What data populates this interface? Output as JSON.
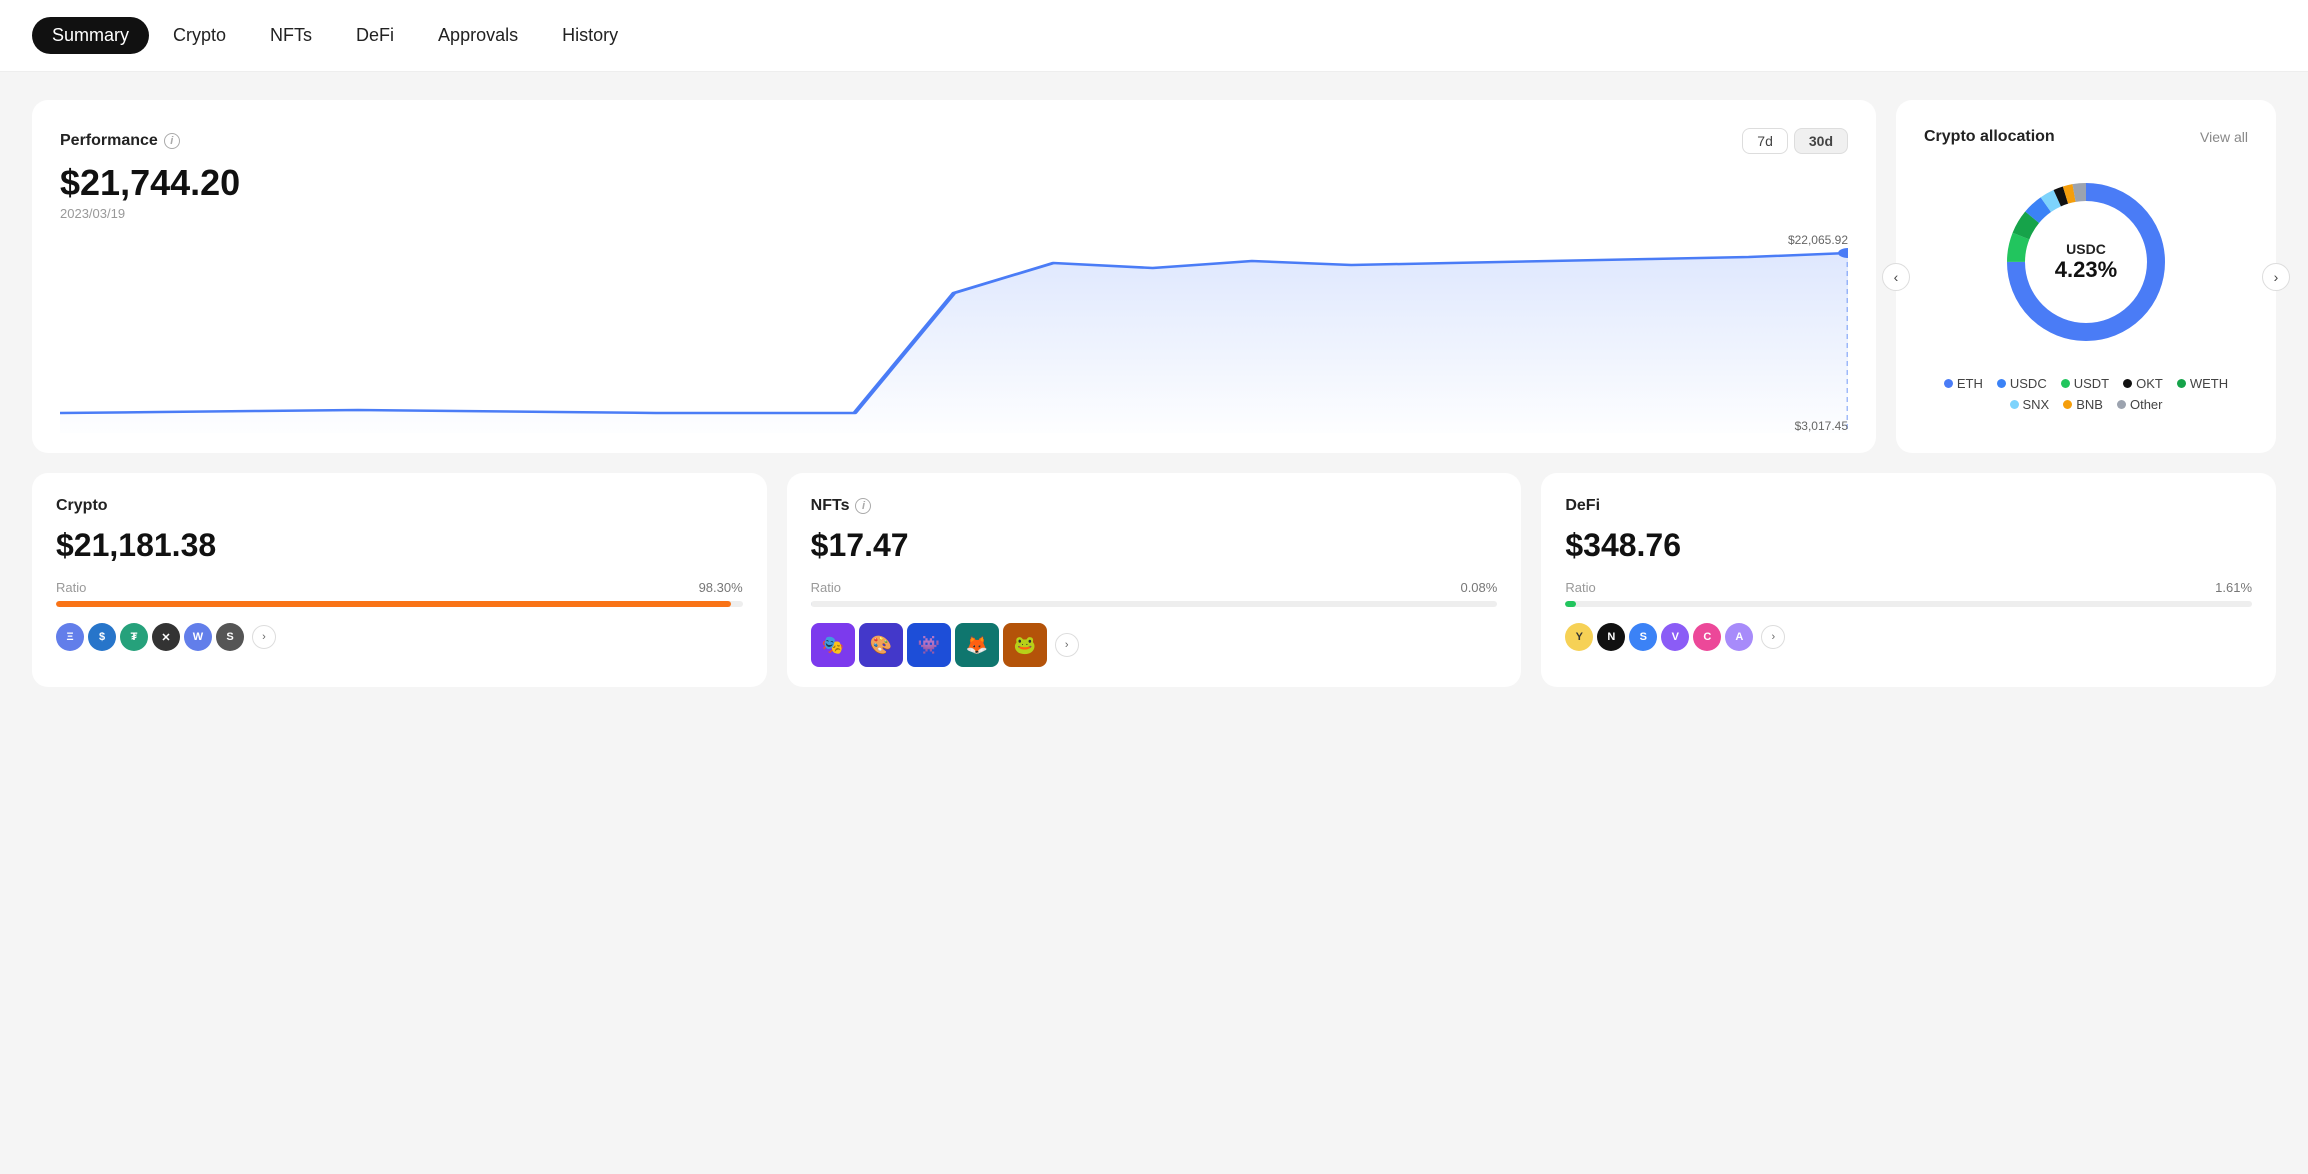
{
  "nav": {
    "items": [
      {
        "id": "summary",
        "label": "Summary",
        "active": true
      },
      {
        "id": "crypto",
        "label": "Crypto",
        "active": false
      },
      {
        "id": "nfts",
        "label": "NFTs",
        "active": false
      },
      {
        "id": "defi",
        "label": "DeFi",
        "active": false
      },
      {
        "id": "approvals",
        "label": "Approvals",
        "active": false
      },
      {
        "id": "history",
        "label": "History",
        "active": false
      }
    ]
  },
  "performance": {
    "title": "Performance",
    "value": "$21,744.20",
    "date": "2023/03/19",
    "high_label": "$22,065.92",
    "low_label": "$3,017.45",
    "time_buttons": [
      {
        "label": "7d",
        "active": false
      },
      {
        "label": "30d",
        "active": true
      }
    ]
  },
  "allocation": {
    "title": "Crypto allocation",
    "view_all": "View all",
    "center_label": "USDC",
    "center_pct": "4.23%",
    "legend": [
      {
        "label": "ETH",
        "color": "#4A7CF6"
      },
      {
        "label": "USDC",
        "color": "#3B82F6"
      },
      {
        "label": "USDT",
        "color": "#22C55E"
      },
      {
        "label": "OKT",
        "color": "#111"
      },
      {
        "label": "WETH",
        "color": "#16A34A"
      },
      {
        "label": "SNX",
        "color": "#7DD3FC"
      },
      {
        "label": "BNB",
        "color": "#F59E0B"
      },
      {
        "label": "Other",
        "color": "#9CA3AF"
      }
    ],
    "donut_segments": [
      {
        "label": "ETH",
        "value": 75,
        "color": "#4A7CF6"
      },
      {
        "label": "USDC",
        "value": 4.23,
        "color": "#3B82F6"
      },
      {
        "label": "USDT",
        "value": 6,
        "color": "#22C55E"
      },
      {
        "label": "OKT",
        "value": 2,
        "color": "#111"
      },
      {
        "label": "WETH",
        "value": 5,
        "color": "#16A34A"
      },
      {
        "label": "SNX",
        "value": 3,
        "color": "#7DD3FC"
      },
      {
        "label": "BNB",
        "value": 2,
        "color": "#F59E0B"
      },
      {
        "label": "Other",
        "value": 2.77,
        "color": "#9CA3AF"
      }
    ]
  },
  "crypto_card": {
    "title": "Crypto",
    "value": "$21,181.38",
    "ratio_label": "Ratio",
    "ratio_pct": "98.30%",
    "bar_color": "#F97316",
    "bar_width": "98.30",
    "icons": [
      {
        "bg": "#627EEA",
        "letter": "Ξ"
      },
      {
        "bg": "#2775CA",
        "letter": "$"
      },
      {
        "bg": "#26A17B",
        "letter": "₮"
      },
      {
        "bg": "#333",
        "letter": "✕"
      },
      {
        "bg": "#627EEA",
        "letter": "W"
      },
      {
        "bg": "#555",
        "letter": "S"
      }
    ]
  },
  "nfts_card": {
    "title": "NFTs",
    "value": "$17.47",
    "ratio_label": "Ratio",
    "ratio_pct": "0.08%",
    "bar_color": "#E5E7EB",
    "bar_width": "0.08",
    "thumbs": [
      {
        "color": "#7C3AED",
        "emoji": "🎭"
      },
      {
        "color": "#4338CA",
        "emoji": "🎨"
      },
      {
        "color": "#1D4ED8",
        "emoji": "👾"
      },
      {
        "color": "#0F766E",
        "emoji": "🦊"
      },
      {
        "color": "#B45309",
        "emoji": "🐸"
      }
    ]
  },
  "defi_card": {
    "title": "DeFi",
    "value": "$348.76",
    "ratio_label": "Ratio",
    "ratio_pct": "1.61%",
    "bar_color": "#22C55E",
    "bar_width": "1.61",
    "icons": [
      {
        "bg": "#F6D156",
        "letter": "Y"
      },
      {
        "bg": "#111",
        "letter": "N"
      },
      {
        "bg": "#3B82F6",
        "letter": "S"
      },
      {
        "bg": "#8B5CF6",
        "letter": "V"
      },
      {
        "bg": "#EC4899",
        "letter": "C"
      },
      {
        "bg": "#A78BFA",
        "letter": "A"
      }
    ]
  }
}
